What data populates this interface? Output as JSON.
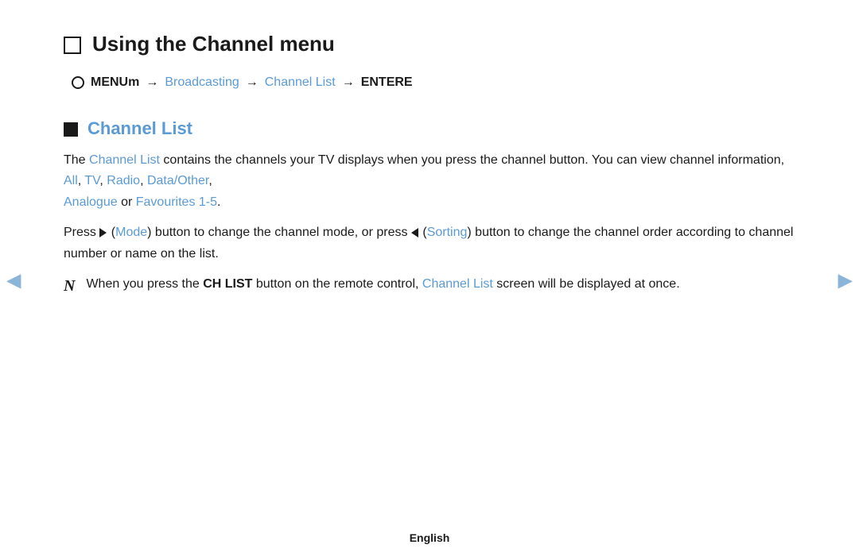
{
  "page": {
    "title": "Using the Channel menu",
    "footer_language": "English"
  },
  "menu_path": {
    "circle_label": "O",
    "menu_item": "MENUm",
    "arrow1": "→",
    "step1": "Broadcasting",
    "arrow2": "→",
    "step2": "Channel List",
    "arrow3": "→",
    "step3": "ENTERE"
  },
  "subsection": {
    "title": "Channel List",
    "paragraph1_prefix": "The ",
    "paragraph1_link1": "Channel List",
    "paragraph1_mid1": " contains the channels your TV displays when you press the channel button. You can view channel information, ",
    "paragraph1_link2": "All",
    "paragraph1_sep1": ", ",
    "paragraph1_link3": "TV",
    "paragraph1_sep2": ", ",
    "paragraph1_link4": "Radio",
    "paragraph1_sep3": ", ",
    "paragraph1_link5": "Data/Other",
    "paragraph1_sep4": ", ",
    "paragraph1_link6": "Analogue",
    "paragraph1_mid2": " or ",
    "paragraph1_link7": "Favourites 1-5",
    "paragraph1_suffix": ".",
    "paragraph2_prefix": "Press ▶ (",
    "paragraph2_link1": "Mode",
    "paragraph2_mid": ") button to change the channel mode, or press ◀ (",
    "paragraph2_link2": "Sorting",
    "paragraph2_suffix": ") button to change the channel order according to channel number or name on the list.",
    "note_n": "N",
    "note_prefix": "When you press the ",
    "note_bold": "CH LIST",
    "note_mid": " button on the remote control, ",
    "note_link": "Channel List",
    "note_suffix": " screen will be displayed at once."
  },
  "nav": {
    "left_arrow": "◀",
    "right_arrow": "▶"
  }
}
